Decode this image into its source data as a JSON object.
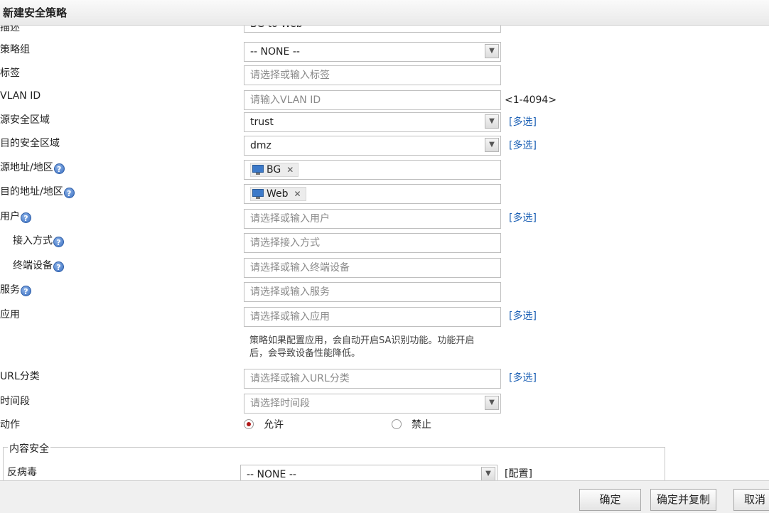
{
  "dialog": {
    "title": "新建安全策略"
  },
  "form": {
    "description": {
      "label": "描述",
      "value": "BG to Web"
    },
    "policy_group": {
      "label": "策略组",
      "value": "-- NONE --"
    },
    "tags": {
      "label": "标签",
      "placeholder": "请选择或输入标签"
    },
    "vlan_id": {
      "label": "VLAN ID",
      "placeholder": "请输入VLAN ID",
      "range": "<1-4094>"
    },
    "source_zone": {
      "label": "源安全区域",
      "value": "trust",
      "multi_select": "[多选]"
    },
    "dest_zone": {
      "label": "目的安全区域",
      "value": "dmz",
      "multi_select": "[多选]"
    },
    "source_address": {
      "label": "源地址/地区",
      "tags": [
        "BG"
      ]
    },
    "dest_address": {
      "label": "目的地址/地区",
      "tags": [
        "Web"
      ]
    },
    "user": {
      "label": "用户",
      "placeholder": "请选择或输入用户",
      "multi_select": "[多选]"
    },
    "access_method": {
      "label": "接入方式",
      "placeholder": "请选择接入方式"
    },
    "terminal_device": {
      "label": "终端设备",
      "placeholder": "请选择或输入终端设备"
    },
    "service": {
      "label": "服务",
      "placeholder": "请选择或输入服务"
    },
    "application": {
      "label": "应用",
      "placeholder": "请选择或输入应用",
      "multi_select": "[多选]",
      "hint_line1": "策略如果配置应用，会自动开启SA识别功能。功能开启",
      "hint_line2": "后，会导致设备性能降低。"
    },
    "url_category": {
      "label": "URL分类",
      "placeholder": "请选择或输入URL分类",
      "multi_select": "[多选]"
    },
    "time_range": {
      "label": "时间段",
      "placeholder": "请选择时间段"
    },
    "action": {
      "label": "动作",
      "options": [
        "允许",
        "禁止"
      ],
      "selected": "允许"
    },
    "content_security": {
      "legend": "内容安全",
      "antivirus": {
        "label": "反病毒",
        "value": "-- NONE --",
        "config_link": "[配置]"
      }
    }
  },
  "help_glyph": "?",
  "icons": {
    "help": "help-icon",
    "host": "host-pc-icon",
    "remove": "remove-x-icon",
    "dropdown": "chevron-down-icon"
  },
  "buttons": {
    "ok": "确定",
    "ok_copy": "确定并复制",
    "cancel": "取消"
  },
  "colors": {
    "link": "#1a5fb4",
    "radio_selected": "#b01818"
  }
}
